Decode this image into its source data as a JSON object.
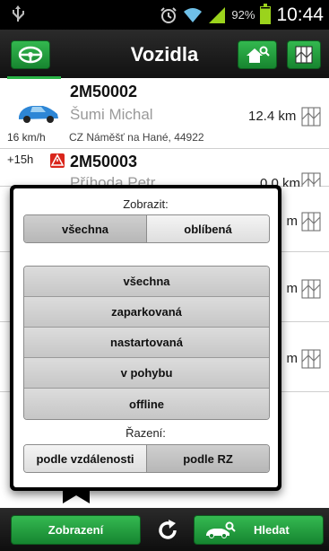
{
  "status_bar": {
    "battery": "92%",
    "time": "10:44",
    "icons": [
      "usb-icon",
      "alarm-icon",
      "wifi-icon",
      "signal-icon",
      "battery-icon"
    ]
  },
  "action_bar": {
    "title": "Vozidla",
    "left_icon": "steering-wheel-icon",
    "right_icons": [
      "home-search-icon",
      "map-icon"
    ],
    "accent": "#29b346"
  },
  "vehicles": [
    {
      "plate": "2M50002",
      "driver": "Šumi Michal",
      "distance": "12.4 km",
      "speed": "16 km/h",
      "address": "CZ Náměšť na Hané, 44922",
      "car_color": "blue"
    },
    {
      "plate": "2M50003",
      "driver": "Příhoda Petr",
      "distance": "0.0 km",
      "time_ago": "+15h",
      "car_color": "red"
    }
  ],
  "peek_distances": [
    "m",
    "m",
    "m"
  ],
  "popup": {
    "show_label": "Zobrazit:",
    "show_options": [
      "všechna",
      "oblíbená"
    ],
    "filters": [
      "všechna",
      "zaparkovaná",
      "nastartovaná",
      "v pohybu",
      "offline"
    ],
    "sort_label": "Řazení:",
    "sort_options": [
      "podle vzdálenosti",
      "podle RZ"
    ]
  },
  "bottom_bar": {
    "view_label": "Zobrazení",
    "search_label": "Hledat"
  }
}
